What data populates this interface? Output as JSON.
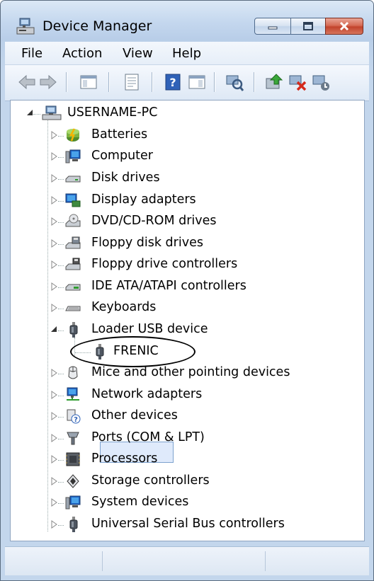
{
  "window": {
    "title": "Device Manager"
  },
  "menu": [
    "File",
    "Action",
    "View",
    "Help"
  ],
  "toolbar_icons": [
    "back-icon",
    "forward-icon",
    "show-hide-console-tree-icon",
    "properties-icon",
    "help-icon",
    "action-pane-icon",
    "scan-hardware-changes-icon",
    "update-driver-icon",
    "uninstall-icon",
    "disable-icon"
  ],
  "tree": {
    "root": "USERNAME-PC",
    "items": [
      {
        "label": "Batteries",
        "icon": "battery-icon"
      },
      {
        "label": "Computer",
        "icon": "computer-icon"
      },
      {
        "label": "Disk drives",
        "icon": "disk-drive-icon"
      },
      {
        "label": "Display adapters",
        "icon": "display-adapter-icon"
      },
      {
        "label": "DVD/CD-ROM drives",
        "icon": "dvd-drive-icon"
      },
      {
        "label": "Floppy disk drives",
        "icon": "floppy-drive-icon"
      },
      {
        "label": "Floppy drive controllers",
        "icon": "floppy-controller-icon"
      },
      {
        "label": "IDE ATA/ATAPI controllers",
        "icon": "ide-controller-icon"
      },
      {
        "label": "Keyboards",
        "icon": "keyboard-icon"
      },
      {
        "label": "Loader USB device",
        "icon": "usb-plug-icon",
        "expanded": true
      },
      {
        "label": "FRENIC",
        "icon": "usb-plug-icon",
        "child": true,
        "selected": true
      },
      {
        "label": "Mice and other pointing devices",
        "icon": "mouse-icon"
      },
      {
        "label": "Network adapters",
        "icon": "network-adapter-icon"
      },
      {
        "label": "Other devices",
        "icon": "unknown-device-icon"
      },
      {
        "label": "Ports (COM & LPT)",
        "icon": "port-icon"
      },
      {
        "label": "Processors",
        "icon": "processor-icon"
      },
      {
        "label": "Storage controllers",
        "icon": "storage-controller-icon"
      },
      {
        "label": "System devices",
        "icon": "system-device-icon"
      },
      {
        "label": "Universal Serial Bus controllers",
        "icon": "usb-plug-icon"
      }
    ]
  },
  "colors": {
    "selection_fill": "#dfeafb",
    "selection_border": "#7da2ce",
    "close_button": "#c2432c"
  }
}
